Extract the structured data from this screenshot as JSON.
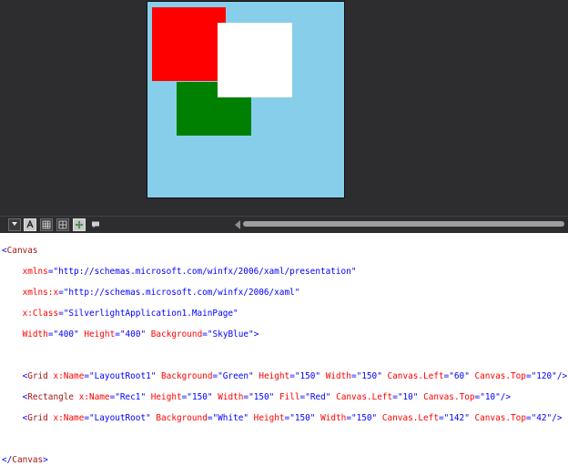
{
  "designer": {
    "canvas_background": "SkyBlue",
    "colors": {
      "canvas": "#87ceeb",
      "green": "#008000",
      "red": "#ff0000",
      "white": "#ffffff"
    }
  },
  "toolbar": {
    "buttons": [
      {
        "name": "chevron-down-icon"
      },
      {
        "name": "snapping-icon"
      },
      {
        "name": "grid-icon"
      },
      {
        "name": "split-grid-icon"
      },
      {
        "name": "move-tool-icon"
      },
      {
        "name": "comment-icon"
      }
    ]
  },
  "code": {
    "canvas_open": {
      "lt": "<",
      "tag": "Canvas"
    },
    "xmlns": {
      "attr": "xmlns",
      "value": "\"http://schemas.microsoft.com/winfx/2006/xaml/presentation\""
    },
    "xmlns_x": {
      "attr": "xmlns:x",
      "value": "\"http://schemas.microsoft.com/winfx/2006/xaml\""
    },
    "x_class": {
      "attr": "x:Class",
      "value": "\"SilverlightApplication1.MainPage\""
    },
    "canvas_size": {
      "width_attr": "Width",
      "width_value": "\"400\"",
      "height_attr": "Height",
      "height_value": "\"400\"",
      "bg_attr": "Background",
      "bg_value": "\"SkyBlue\"",
      "close": ">"
    },
    "grid1": {
      "lt": "<",
      "tag": "Grid",
      "name_attr": "x:Name",
      "name_value": "\"LayoutRoot1\"",
      "bg_attr": "Background",
      "bg_value": "\"Green\"",
      "height_attr": "Height",
      "height_value": "\"150\"",
      "width_attr": "Width",
      "width_value": "\"150\"",
      "left_attr": "Canvas.Left",
      "left_value": "\"60\"",
      "top_attr": "Canvas.Top",
      "top_value": "\"120\"",
      "close": "/>"
    },
    "rect": {
      "lt": "<",
      "tag": "Rectangle",
      "name_attr": "x:Name",
      "name_value": "\"Rec1\"",
      "height_attr": "Height",
      "height_value": "\"150\"",
      "width_attr": "Width",
      "width_value": "\"150\"",
      "fill_attr": "Fill",
      "fill_value": "\"Red\"",
      "left_attr": "Canvas.Left",
      "left_value": "\"10\"",
      "top_attr": "Canvas.Top",
      "top_value": "\"10\"",
      "close": "/>"
    },
    "grid2": {
      "lt": "<",
      "tag": "Grid",
      "name_attr": "x:Name",
      "name_value": "\"LayoutRoot\"",
      "bg_attr": "Background",
      "bg_value": "\"White\"",
      "height_attr": "Height",
      "height_value": "\"150\"",
      "width_attr": "Width",
      "width_value": "\"150\"",
      "left_attr": "Canvas.Left",
      "left_value": "\"142\"",
      "top_attr": "Canvas.Top",
      "top_value": "\"42\"",
      "close": "/>"
    },
    "canvas_close": {
      "lt": "</",
      "tag": "Canvas",
      "gt": ">"
    }
  }
}
